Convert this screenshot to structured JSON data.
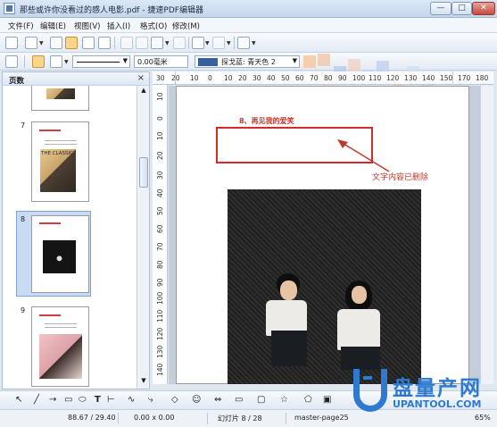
{
  "window": {
    "title": "那些或许你没看过的感人电影.pdf - 捷速PDF编辑器",
    "buttons": {
      "minimize": "—",
      "maximize": "□",
      "close": "✕"
    }
  },
  "menu": [
    "文件(F)",
    "编辑(E)",
    "视图(V)",
    "插入(I)",
    "格式(O)",
    "修改(M)"
  ],
  "format_bar": {
    "line_width": "0.00毫米",
    "line_color": "探戈蓝: 青天色 2"
  },
  "slide_panel": {
    "title": "页数",
    "close": "×",
    "slides": [
      {
        "number": "7",
        "photo_caption": "THE CLASSIC"
      },
      {
        "number": "8",
        "selected": true
      },
      {
        "number": "9"
      }
    ]
  },
  "ruler": {
    "h_ticks": [
      "30",
      "20",
      "10",
      "0",
      "10",
      "20",
      "30",
      "40",
      "50",
      "60",
      "70",
      "80",
      "90",
      "100",
      "110",
      "120",
      "130",
      "140",
      "150",
      "160",
      "170",
      "180"
    ],
    "h_ticks_right": [
      "170",
      "180"
    ],
    "v_ticks": [
      "10",
      "0",
      "10",
      "20",
      "30",
      "40",
      "50",
      "60",
      "70",
      "80",
      "90",
      "100",
      "110",
      "120",
      "130",
      "140",
      "150",
      "160",
      "170",
      "180"
    ]
  },
  "slide": {
    "heading": "8、再见我的爱笑",
    "annotation": "文字内容已删除",
    "box_color": "#d42a2a"
  },
  "status": {
    "position": "88.67 / 29.40",
    "size": "0.00 x 0.00",
    "slide": "幻灯片 8 / 28",
    "master": "master-page25",
    "zoom": "65%"
  },
  "watermark": {
    "title": "盘量产网",
    "url": "UPANTOOL.COM"
  },
  "colors": {
    "annotation": "#c0392b",
    "watermark": "#2f7ad1",
    "swatch": "#365f9f"
  }
}
